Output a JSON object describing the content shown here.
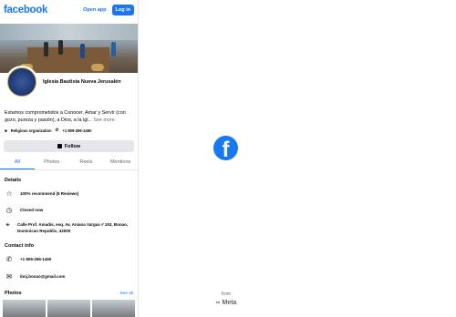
{
  "header": {
    "logo": "facebook",
    "open_app": "Open app",
    "login": "Log in"
  },
  "page": {
    "name": "Iglesia Bautista Nueva Jerusalén",
    "about_text": "Estamos comprometidos a Conocer, Amar y Servir (con gozo, pureza y pasión), a Dios, a la igl...",
    "see_more": "See more",
    "category": "Religious organization",
    "phone_short": "+1 809-296-1460"
  },
  "actions": {
    "follow": "Follow"
  },
  "tabs": [
    {
      "label": "All",
      "active": true
    },
    {
      "label": "Photos",
      "active": false
    },
    {
      "label": "Reels",
      "active": false
    },
    {
      "label": "Mentions",
      "active": false
    }
  ],
  "details": {
    "title": "Details",
    "recommend": "100% recommend (6 Reviews)",
    "hours": "Closed now",
    "address": "Calle Prof. Amadis, esq. Av. Aniana Vargas # 153, Bonao, Dominican Republic, 42000"
  },
  "contact": {
    "title": "Contact info",
    "phone": "+1 809-296-1460",
    "email": "ibnj.bonao@gmail.com"
  },
  "photos": {
    "title": "Photos",
    "see_all": "See all"
  },
  "splash": {
    "icon_letter": "f",
    "from": "from",
    "meta": "∞ Meta"
  },
  "colors": {
    "brand": "#1877f2",
    "secondary_text": "#65676b",
    "button_bg": "#e4e6eb"
  }
}
